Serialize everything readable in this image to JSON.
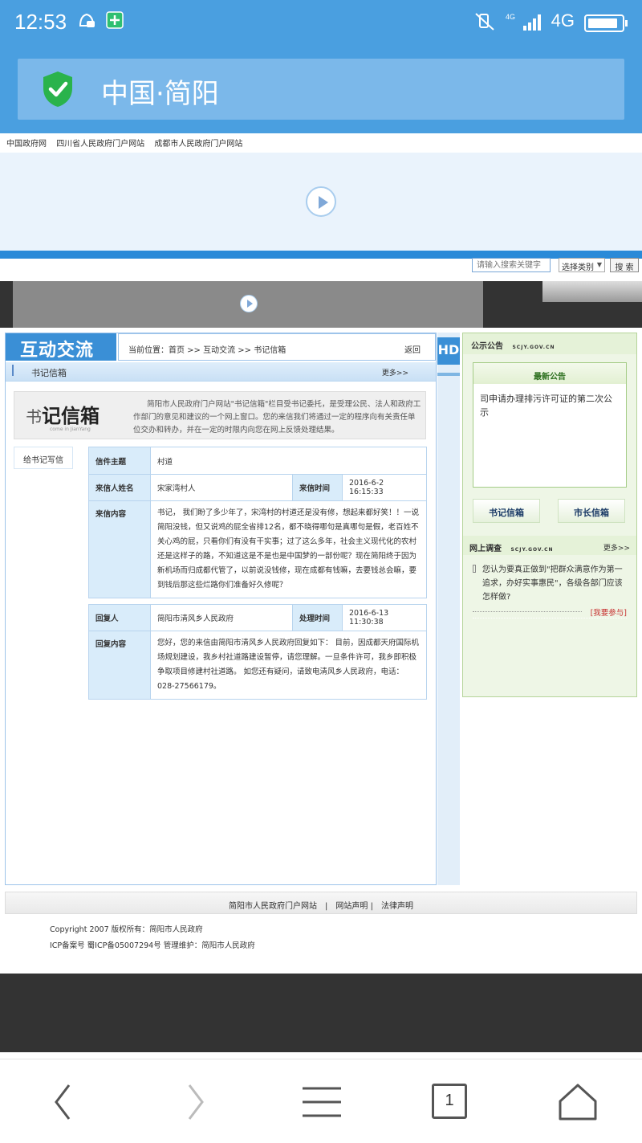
{
  "status_bar": {
    "time": "12:53",
    "network": "4G"
  },
  "address_bar": {
    "site_title": "中国·简阳"
  },
  "top_links": [
    "中国政府网",
    "四川省人民政府门户网站",
    "成都市人民政府门户网站"
  ],
  "search": {
    "placeholder": "请输入搜索关键字",
    "category": "选择类别",
    "button": "搜 索"
  },
  "main": {
    "section_title": "互动交流",
    "breadcrumb": "当前位置：首页 >> 互动交流 >> 书记信箱",
    "back": "返回",
    "sub_title": "书记信箱",
    "more": "更多>>",
    "logo_text_a": "书",
    "logo_text_b": "记",
    "logo_text_c": "信箱",
    "logo_sub": "come in JianYang",
    "intro": "简阳市人民政府门户网站\"书记信箱\"栏目受书记委托，是受理公民、法人和政府工作部门的意见和建议的一个网上窗口。您的来信我们将通过一定的程序向有关责任单位交办和转办，并在一定的时限内向您在网上反馈处理结果。",
    "write_button": "给书记写信",
    "letter": {
      "subject_label": "信件主题",
      "subject": "村道",
      "sender_label": "来信人姓名",
      "sender": "宋家湾村人",
      "time_label": "来信时间",
      "time": "2016-6-2 16:15:33",
      "content_label": "来信内容",
      "content": "书记， 我们盼了多少年了，宋湾村的村道还是没有修，想起来都好笑！！一说简阳没钱，但又说鸡的屁全省排12名，都不晓得哪句是真哪句是假，老百姓不关心鸡的屁，只看你们有没有干实事；过了这么多年，社会主义现代化的农村还是这样子的路，不知道这是不是也是中国梦的一部份呢？现在简阳终于因为新机场而归成都代管了，以前说没钱修，现在成都有钱嘛，去要钱总会嘛，要到钱后那这些烂路你们准备好久修呢？"
    },
    "reply": {
      "replier_label": "回复人",
      "replier": "简阳市清风乡人民政府",
      "time_label": "处理时间",
      "time": "2016-6-13 11:30:38",
      "content_label": "回复内容",
      "content": "您好，您的来信由简阳市清风乡人民政府回复如下： 目前，因成都天府国际机场规划建设，我乡村社道路建设暂停，请您理解。一旦条件许可，我乡即积极争取项目修建村社道路。 如您还有疑问，请致电清风乡人民政府，电话： 028-27566179。"
    }
  },
  "hd_label": "HD",
  "sidebar": {
    "notice_title": "公示公告",
    "site_url": "SCJY.GOV.CN",
    "latest_title": "最新公告",
    "notice_text": "司申请办理排污许可证的第二次公示",
    "secretary_button": "书记信箱",
    "mayor_button": "市长信箱",
    "survey_title": "网上调查",
    "survey_more": "更多>>",
    "survey_question": "您认为要真正做到\"把群众满意作为第一追求，办好实事惠民\"，各级各部门应该怎样做?",
    "survey_link": "[我要参与]"
  },
  "footer": {
    "links": "简阳市人民政府门户网站　|　网站声明 |　法律声明",
    "copyright": "Copyright 2007 版权所有：简阳市人民政府",
    "icp": "ICP备案号 蜀ICP备05007294号 管理维护：简阳市人民政府"
  },
  "browser_nav": {
    "tab_count": "1"
  },
  "colors": {
    "accent": "#4a9fe0",
    "section_blue": "#3a8fd6",
    "green_panel": "#eef6e6",
    "alert_red": "#c83232"
  }
}
